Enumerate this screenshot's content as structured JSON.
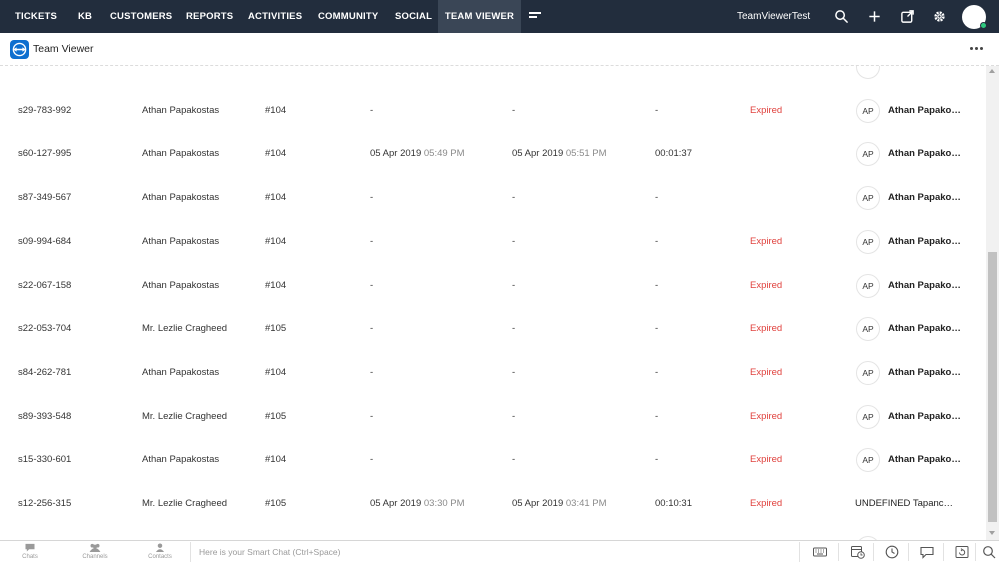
{
  "topnav": {
    "tabs": [
      {
        "label": "TICKETS",
        "active": false
      },
      {
        "label": "KB",
        "active": false
      },
      {
        "label": "CUSTOMERS",
        "active": false
      },
      {
        "label": "REPORTS",
        "active": false
      },
      {
        "label": "ACTIVITIES",
        "active": false
      },
      {
        "label": "COMMUNITY",
        "active": false
      },
      {
        "label": "SOCIAL",
        "active": false
      },
      {
        "label": "TEAM VIEWER",
        "active": true
      }
    ],
    "more_icon": "hamburger-icon",
    "portal_name": "TeamViewerTest",
    "icons": [
      "search-icon",
      "plus-icon",
      "external-link-icon",
      "gear-icon",
      "avatar"
    ],
    "colors": {
      "background": "#222d3d",
      "active_tab": "#3a4656"
    }
  },
  "subheader": {
    "title": "Team Viewer",
    "logo_icon": "teamviewer-logo-icon",
    "more_icon": "more-options-icon"
  },
  "table": {
    "rows": [
      {
        "session": "",
        "customer": "",
        "ticket": "",
        "start_date": "",
        "start_time": "",
        "end_date": "",
        "end_time": "",
        "duration": "",
        "status": "",
        "agent_initials": "",
        "agent_name": "",
        "partial": "top"
      },
      {
        "session": "s29-783-992",
        "customer": "Athan Papakostas",
        "ticket": "#104",
        "start_date": "-",
        "start_time": "",
        "end_date": "-",
        "end_time": "",
        "duration": "-",
        "status": "Expired",
        "agent_initials": "AP",
        "agent_name": "Athan Papakostas"
      },
      {
        "session": "s60-127-995",
        "customer": "Athan Papakostas",
        "ticket": "#104",
        "start_date": "05 Apr 2019",
        "start_time": "05:49 PM",
        "end_date": "05 Apr 2019",
        "end_time": "05:51 PM",
        "duration": "00:01:37",
        "status": "",
        "agent_initials": "AP",
        "agent_name": "Athan Papakostas"
      },
      {
        "session": "s87-349-567",
        "customer": "Athan Papakostas",
        "ticket": "#104",
        "start_date": "-",
        "start_time": "",
        "end_date": "-",
        "end_time": "",
        "duration": "-",
        "status": "",
        "agent_initials": "AP",
        "agent_name": "Athan Papakostas"
      },
      {
        "session": "s09-994-684",
        "customer": "Athan Papakostas",
        "ticket": "#104",
        "start_date": "-",
        "start_time": "",
        "end_date": "-",
        "end_time": "",
        "duration": "-",
        "status": "Expired",
        "agent_initials": "AP",
        "agent_name": "Athan Papakostas"
      },
      {
        "session": "s22-067-158",
        "customer": "Athan Papakostas",
        "ticket": "#104",
        "start_date": "-",
        "start_time": "",
        "end_date": "-",
        "end_time": "",
        "duration": "-",
        "status": "Expired",
        "agent_initials": "AP",
        "agent_name": "Athan Papakostas"
      },
      {
        "session": "s22-053-704",
        "customer": "Mr. Lezlie Cragheed",
        "ticket": "#105",
        "start_date": "-",
        "start_time": "",
        "end_date": "-",
        "end_time": "",
        "duration": "-",
        "status": "Expired",
        "agent_initials": "AP",
        "agent_name": "Athan Papakostas"
      },
      {
        "session": "s84-262-781",
        "customer": "Athan Papakostas",
        "ticket": "#104",
        "start_date": "-",
        "start_time": "",
        "end_date": "-",
        "end_time": "",
        "duration": "-",
        "status": "Expired",
        "agent_initials": "AP",
        "agent_name": "Athan Papakostas"
      },
      {
        "session": "s89-393-548",
        "customer": "Mr. Lezlie Cragheed",
        "ticket": "#105",
        "start_date": "-",
        "start_time": "",
        "end_date": "-",
        "end_time": "",
        "duration": "-",
        "status": "Expired",
        "agent_initials": "AP",
        "agent_name": "Athan Papakostas"
      },
      {
        "session": "s15-330-601",
        "customer": "Athan Papakostas",
        "ticket": "#104",
        "start_date": "-",
        "start_time": "",
        "end_date": "-",
        "end_time": "",
        "duration": "-",
        "status": "Expired",
        "agent_initials": "AP",
        "agent_name": "Athan Papakostas"
      },
      {
        "session": "s12-256-315",
        "customer": "Mr. Lezlie Cragheed",
        "ticket": "#105",
        "start_date": "05 Apr 2019",
        "start_time": "03:30 PM",
        "end_date": "05 Apr 2019",
        "end_time": "03:41 PM",
        "duration": "00:10:31",
        "status": "Expired",
        "agent_initials": "",
        "agent_name": "UNDEFINED Tapanco Hot..."
      },
      {
        "session": "",
        "customer": "",
        "ticket": "",
        "start_date": "",
        "start_time": "",
        "end_date": "",
        "end_time": "",
        "duration": "",
        "status": "",
        "agent_initials": "",
        "agent_name": "",
        "partial": "bottom"
      }
    ],
    "colors": {
      "expired": "#e0413d",
      "time": "#8a8a8a"
    }
  },
  "bottombar": {
    "items": [
      {
        "label": "Chats",
        "icon": "chat-bubble-icon"
      },
      {
        "label": "Channels",
        "icon": "channels-icon"
      },
      {
        "label": "Contacts",
        "icon": "contact-icon"
      }
    ],
    "smart_chat_placeholder": "Here is your Smart Chat (Ctrl+Space)",
    "right_icons": [
      "keyboard-icon",
      "calendar-clock-icon",
      "history-icon",
      "message-icon",
      "refresh-window-icon",
      "search-icon"
    ]
  }
}
